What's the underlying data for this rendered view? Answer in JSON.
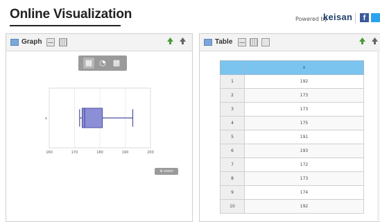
{
  "header": {
    "title": "Online Visualization",
    "powered_by": "Powered by",
    "brand": "keisan",
    "facebook_icon": "f"
  },
  "graph_panel": {
    "title": "Graph",
    "toolbar_icons": [
      "boxplot-icon",
      "pie-icon",
      "bar-icon"
    ],
    "zoom_label": "⊕ zoom"
  },
  "table_panel": {
    "title": "Table",
    "column_header": "x",
    "rows": [
      {
        "n": "1",
        "x": "192"
      },
      {
        "n": "2",
        "x": "173"
      },
      {
        "n": "3",
        "x": "173"
      },
      {
        "n": "4",
        "x": "175"
      },
      {
        "n": "5",
        "x": "191"
      },
      {
        "n": "6",
        "x": "193"
      },
      {
        "n": "7",
        "x": "172"
      },
      {
        "n": "8",
        "x": "173"
      },
      {
        "n": "9",
        "x": "174"
      },
      {
        "n": "10",
        "x": "192"
      }
    ]
  },
  "colors": {
    "box_fill": "#8d8fd6",
    "box_stroke": "#4a4ea0",
    "table_header": "#7bc4ef"
  },
  "chart_data": {
    "type": "boxplot",
    "orientation": "horizontal",
    "category_label": "x",
    "whisker_low": 172,
    "q1": 173,
    "median": 174,
    "q3": 181,
    "whisker_high": 193,
    "xlim": [
      160,
      200
    ],
    "xticks": [
      "160",
      "170",
      "180",
      "190",
      "200"
    ],
    "grid": true
  }
}
